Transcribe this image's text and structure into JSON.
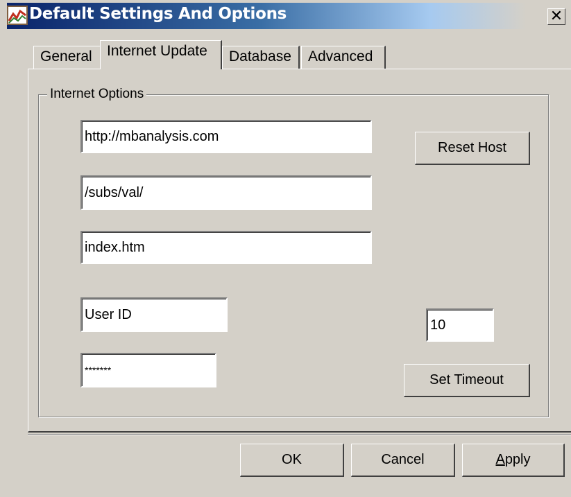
{
  "window": {
    "title": "Default Settings And Options",
    "close_glyph": "✕",
    "app_icon": "chart-icon"
  },
  "tabs": [
    {
      "label": "General",
      "selected": false
    },
    {
      "label": "Internet Update",
      "selected": true
    },
    {
      "label": "Database",
      "selected": false
    },
    {
      "label": "Advanced",
      "selected": false
    }
  ],
  "internet_options": {
    "group_label": "Internet Options",
    "host_value": "http://mbanalysis.com",
    "path_value": "/subs/val/",
    "file_value": "index.htm",
    "user_id_value": "User ID",
    "password_value": "*******",
    "timeout_value": "10",
    "reset_host_label": "Reset Host",
    "set_timeout_label": "Set Timeout"
  },
  "footer": {
    "ok_label": "OK",
    "cancel_label": "Cancel",
    "apply_label_accel": "A",
    "apply_label_rest": "pply"
  },
  "colors": {
    "face": "#d4d0c8",
    "titlebar_start": "#0a246a",
    "titlebar_end": "#a6caf0"
  }
}
